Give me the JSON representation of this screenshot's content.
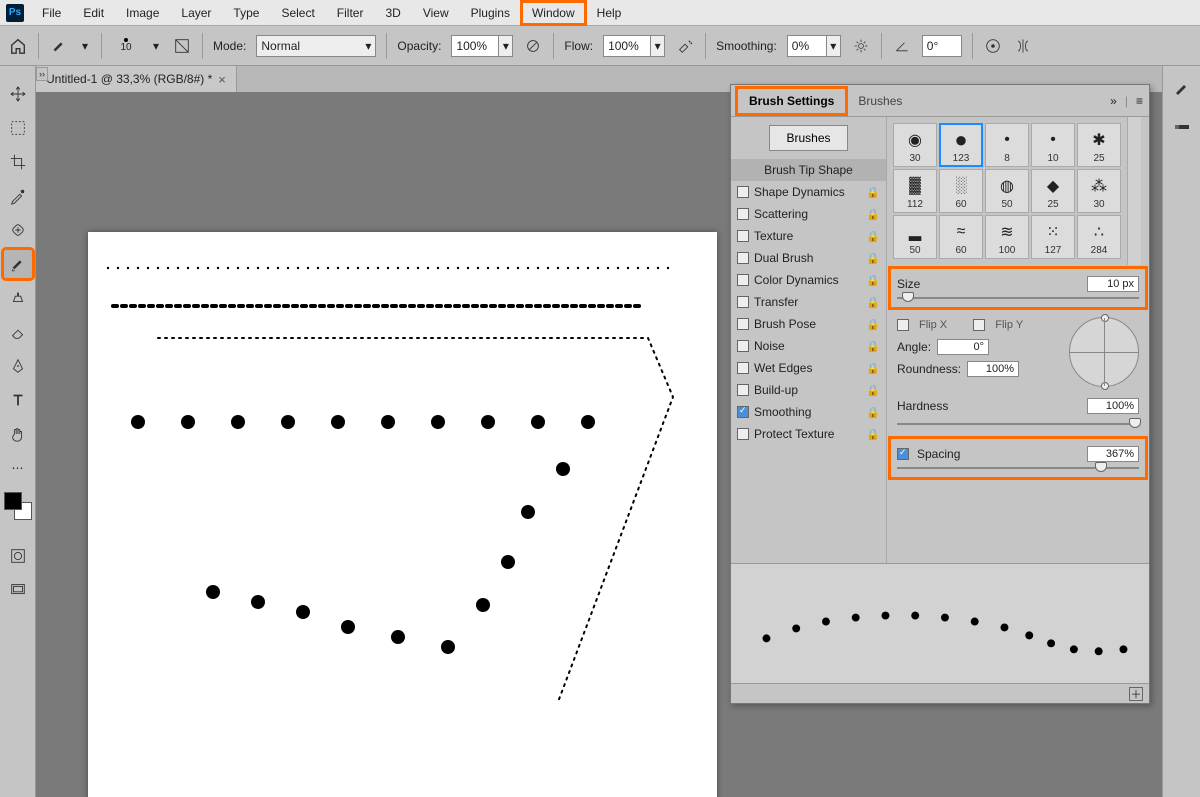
{
  "menu": {
    "items": [
      "File",
      "Edit",
      "Image",
      "Layer",
      "Type",
      "Select",
      "Filter",
      "3D",
      "View",
      "Plugins",
      "Window",
      "Help"
    ],
    "highlight": "Window"
  },
  "options": {
    "brush_size_label": "10",
    "mode_label": "Mode:",
    "mode_value": "Normal",
    "opacity_label": "Opacity:",
    "opacity_value": "100%",
    "flow_label": "Flow:",
    "flow_value": "100%",
    "smoothing_label": "Smoothing:",
    "smoothing_value": "0%",
    "angle_value": "0°"
  },
  "document": {
    "tab_title": "Untitled-1 @ 33,3% (RGB/8#) *"
  },
  "panel": {
    "tabs": {
      "brush_settings": "Brush Settings",
      "brushes": "Brushes"
    },
    "brushes_btn": "Brushes",
    "sections": {
      "tip_shape": "Brush Tip Shape",
      "shape_dynamics": "Shape Dynamics",
      "scattering": "Scattering",
      "texture": "Texture",
      "dual_brush": "Dual Brush",
      "color_dynamics": "Color Dynamics",
      "transfer": "Transfer",
      "brush_pose": "Brush Pose",
      "noise": "Noise",
      "wet_edges": "Wet Edges",
      "buildup": "Build-up",
      "smoothing": "Smoothing",
      "protect_texture": "Protect Texture"
    },
    "brush_cells": [
      {
        "label": "30"
      },
      {
        "label": "123"
      },
      {
        "label": "8"
      },
      {
        "label": "10"
      },
      {
        "label": "25"
      },
      {
        "label": "112"
      },
      {
        "label": "60"
      },
      {
        "label": "50"
      },
      {
        "label": "25"
      },
      {
        "label": "30"
      },
      {
        "label": "50"
      },
      {
        "label": "60"
      },
      {
        "label": "100"
      },
      {
        "label": "127"
      },
      {
        "label": "284"
      }
    ],
    "selected_cell": 1,
    "size_label": "Size",
    "size_value": "10 px",
    "flipx_label": "Flip X",
    "flipy_label": "Flip Y",
    "angle_label": "Angle:",
    "angle_value": "0°",
    "roundness_label": "Roundness:",
    "roundness_value": "100%",
    "hardness_label": "Hardness",
    "hardness_value": "100%",
    "spacing_label": "Spacing",
    "spacing_value": "367%"
  }
}
